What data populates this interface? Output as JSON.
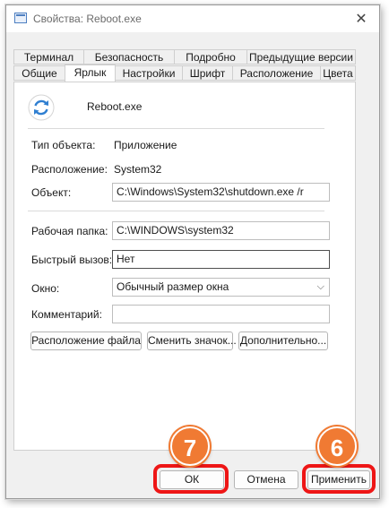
{
  "window": {
    "title": "Свойства: Reboot.exe"
  },
  "tabs_row1": [
    "Терминал",
    "Безопасность",
    "Подробно",
    "Предыдущие версии"
  ],
  "tabs_row2": [
    "Общие",
    "Ярлык",
    "Настройки",
    "Шрифт",
    "Расположение",
    "Цвета"
  ],
  "active_tab": "Ярлык",
  "shortcut": {
    "name": "Reboot.exe",
    "type_label": "Тип объекта:",
    "type_value": "Приложение",
    "location_label": "Расположение:",
    "location_value": "System32",
    "target_label": "Объект:",
    "target_value": "C:\\Windows\\System32\\shutdown.exe /r",
    "start_in_label": "Рабочая папка:",
    "start_in_value": "C:\\WINDOWS\\system32",
    "hotkey_label": "Быстрый вызов:",
    "hotkey_value": "Нет",
    "run_label": "Окно:",
    "run_value": "Обычный размер окна",
    "comment_label": "Комментарий:",
    "comment_value": ""
  },
  "buttons": {
    "open_location": "Расположение файла",
    "change_icon": "Сменить значок...",
    "advanced": "Дополнительно...",
    "ok": "ОК",
    "cancel": "Отмена",
    "apply": "Применить"
  },
  "annotations": {
    "ok_step": "7",
    "apply_step": "6"
  },
  "colors": {
    "highlight": "#ee1616",
    "badge": "#f07a33",
    "icon_blue": "#2f7fd1"
  },
  "icons": {
    "title": "window-icon",
    "close": "close-icon",
    "app": "refresh-icon",
    "dropdown": "chevron-down-icon"
  }
}
